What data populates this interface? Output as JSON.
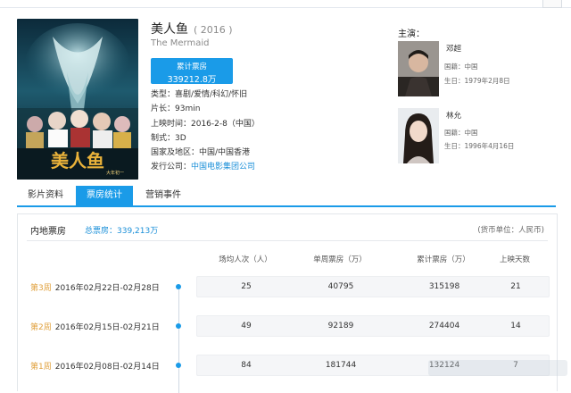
{
  "movie": {
    "title_cn": "美人鱼",
    "year": "( 2016 )",
    "title_en": "The Mermaid",
    "boxoffice_label": "累计票房",
    "boxoffice_value": "339212.8万",
    "type": "类型：喜剧/爱情/科幻/怀旧",
    "length": "片长：93min",
    "release": "上映时间：2016-2-8（中国）",
    "format": "制式：3D",
    "region": "国家及地区：中国/中国香港",
    "distributor_label": "发行公司：",
    "distributor": "中国电影集团公司",
    "poster_title_art": "美人鱼",
    "poster_tag": "大年初一"
  },
  "cast": {
    "heading": "主演：",
    "actors": [
      {
        "name": "邓超",
        "nationality": "国籍：中国",
        "birth": "生日：1979年2月8日"
      },
      {
        "name": "林允",
        "nationality": "国籍：中国",
        "birth": "生日：1996年4月16日"
      }
    ]
  },
  "tabs": [
    "影片资料",
    "票房统计",
    "营销事件"
  ],
  "active_tab": 1,
  "boxoffice": {
    "title": "内地票房",
    "total": "总票房：339,213万",
    "unit": "(货币单位：人民币)",
    "columns": [
      "场均人次（人）",
      "单周票房（万）",
      "累计票房（万）",
      "上映天数"
    ],
    "rows": [
      {
        "week": "第3周",
        "range": "2016年02月22日-02月28日",
        "cells": [
          "25",
          "40795",
          "315198",
          "21"
        ]
      },
      {
        "week": "第2周",
        "range": "2016年02月15日-02月21日",
        "cells": [
          "49",
          "92189",
          "274404",
          "14"
        ]
      },
      {
        "week": "第1周",
        "range": "2016年02月08日-02月14日",
        "cells": [
          "84",
          "181744",
          "132124",
          "7"
        ]
      }
    ]
  },
  "colors": {
    "accent": "#1a9be8",
    "week_label": "#e0a03c",
    "link": "#1a8fd8"
  }
}
